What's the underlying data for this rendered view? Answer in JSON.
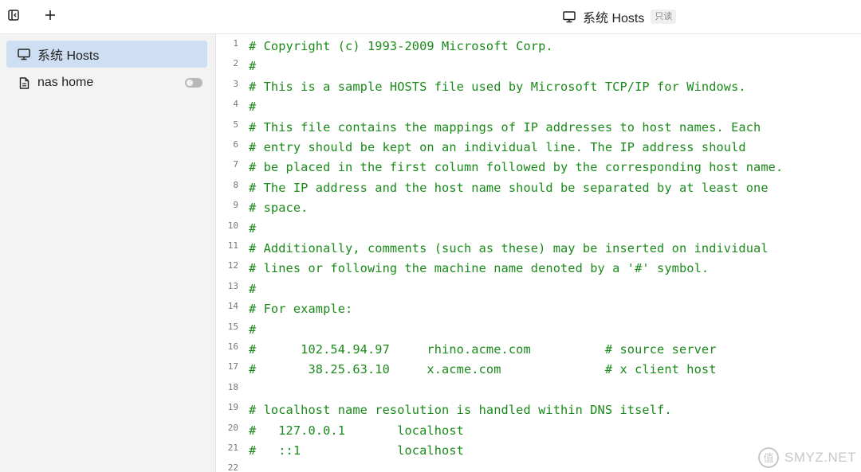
{
  "topbar": {
    "title": "系统 Hosts",
    "readonly_badge": "只读"
  },
  "sidebar": {
    "items": [
      {
        "label": "系统 Hosts",
        "icon": "monitor-icon",
        "active": true
      },
      {
        "label": "nas home",
        "icon": "file-icon",
        "active": false,
        "toggle": "off"
      }
    ]
  },
  "editor": {
    "lines": [
      {
        "n": "1",
        "text": "# Copyright (c) 1993-2009 Microsoft Corp."
      },
      {
        "n": "2",
        "text": "#"
      },
      {
        "n": "3",
        "text": "# This is a sample HOSTS file used by Microsoft TCP/IP for Windows."
      },
      {
        "n": "4",
        "text": "#"
      },
      {
        "n": "5",
        "text": "# This file contains the mappings of IP addresses to host names. Each"
      },
      {
        "n": "6",
        "text": "# entry should be kept on an individual line. The IP address should"
      },
      {
        "n": "7",
        "text": "# be placed in the first column followed by the corresponding host name."
      },
      {
        "n": "8",
        "text": "# The IP address and the host name should be separated by at least one"
      },
      {
        "n": "9",
        "text": "# space."
      },
      {
        "n": "10",
        "text": "#"
      },
      {
        "n": "11",
        "text": "# Additionally, comments (such as these) may be inserted on individual"
      },
      {
        "n": "12",
        "text": "# lines or following the machine name denoted by a '#' symbol."
      },
      {
        "n": "13",
        "text": "#"
      },
      {
        "n": "14",
        "text": "# For example:"
      },
      {
        "n": "15",
        "text": "#"
      },
      {
        "n": "16",
        "text": "#      102.54.94.97     rhino.acme.com          # source server"
      },
      {
        "n": "17",
        "text": "#       38.25.63.10     x.acme.com              # x client host"
      },
      {
        "n": "18",
        "text": ""
      },
      {
        "n": "19",
        "text": "# localhost name resolution is handled within DNS itself."
      },
      {
        "n": "20",
        "text": "#   127.0.0.1       localhost"
      },
      {
        "n": "21",
        "text": "#   ::1             localhost"
      },
      {
        "n": "22",
        "text": ""
      }
    ]
  },
  "watermark": {
    "text": "SMYZ.NET",
    "logo": "值-logo"
  },
  "colors": {
    "code_comment": "#1a8a1a",
    "sidebar_bg": "#f3f3f3",
    "active_item_bg": "#cfdff3"
  }
}
